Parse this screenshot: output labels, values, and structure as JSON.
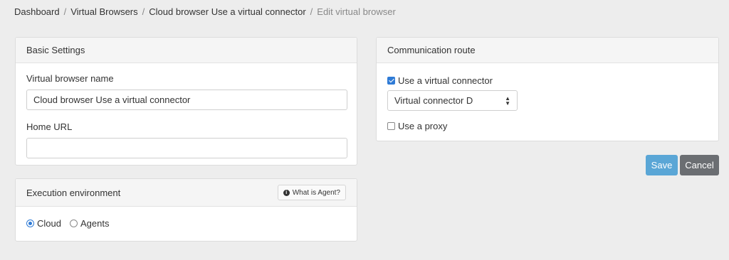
{
  "breadcrumb": {
    "items": [
      "Dashboard",
      "Virtual Browsers",
      "Cloud browser Use a virtual connector"
    ],
    "active": "Edit virtual browser",
    "separator": "/"
  },
  "basic_settings": {
    "title": "Basic Settings",
    "name_label": "Virtual browser name",
    "name_value": "Cloud browser Use a virtual connector",
    "home_url_label": "Home URL",
    "home_url_value": ""
  },
  "execution_environment": {
    "title": "Execution environment",
    "help_button": "What is Agent?",
    "options": [
      {
        "label": "Cloud",
        "checked": true
      },
      {
        "label": "Agents",
        "checked": false
      }
    ]
  },
  "communication_route": {
    "title": "Communication route",
    "virtual_connector_label": "Use a virtual connector",
    "virtual_connector_checked": true,
    "connector_selected": "Virtual connector D",
    "proxy_label": "Use a proxy",
    "proxy_checked": false
  },
  "actions": {
    "save": "Save",
    "cancel": "Cancel"
  },
  "colors": {
    "accent": "#2f7bd6",
    "save_button": "#5aa6d6",
    "cancel_button": "#6b6e72",
    "background": "#ededed"
  }
}
